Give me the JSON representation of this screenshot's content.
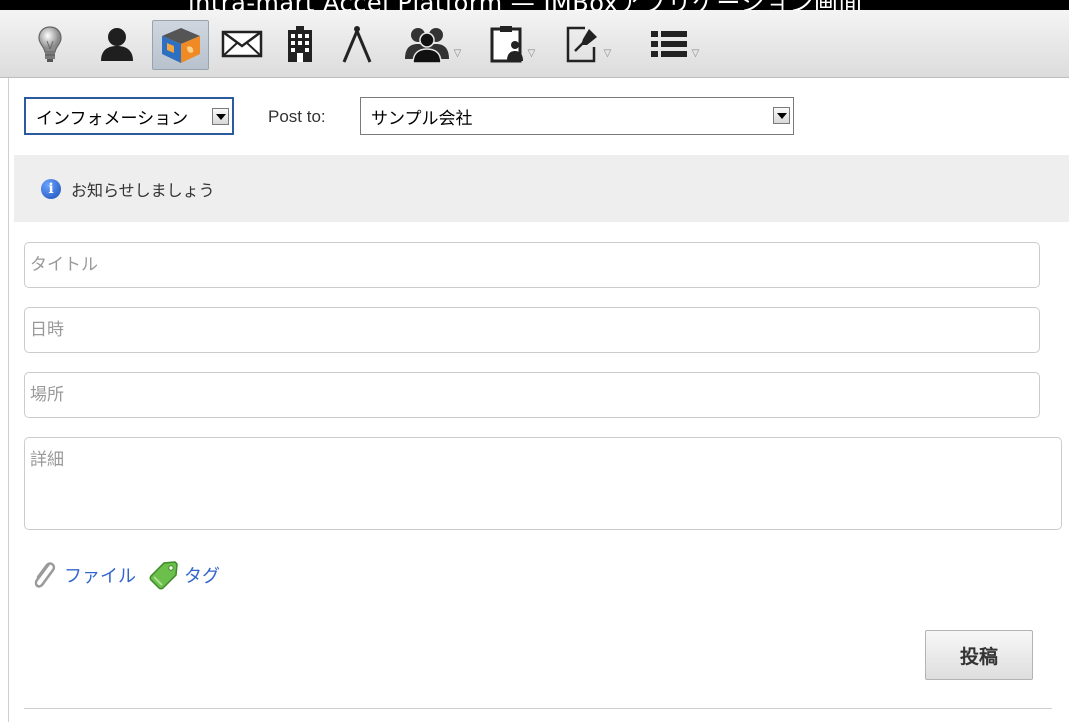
{
  "window": {
    "title": "intra-mart Accel Platform — IMBoxアプリケーション画面"
  },
  "toolbar": {
    "items": [
      {
        "name": "lightbulb-icon",
        "label": "",
        "dropdown": false
      },
      {
        "name": "user-icon",
        "label": "",
        "dropdown": false
      },
      {
        "name": "company-cube-icon",
        "label": "",
        "dropdown": false,
        "active": true
      },
      {
        "name": "mail-icon",
        "label": "",
        "dropdown": false
      },
      {
        "name": "building-icon",
        "label": "",
        "dropdown": false
      },
      {
        "name": "compass-icon",
        "label": "",
        "dropdown": false
      },
      {
        "name": "group-icon",
        "label": "",
        "dropdown": true
      },
      {
        "name": "clipboard-user-icon",
        "label": "",
        "dropdown": true
      },
      {
        "name": "document-pin-icon",
        "label": "",
        "dropdown": true
      },
      {
        "name": "list-icon",
        "label": "",
        "dropdown": true
      }
    ]
  },
  "composer": {
    "type_select": {
      "value": "インフォメーション"
    },
    "post_to_label": "Post to:",
    "post_to_select": {
      "value": "サンプル会社"
    },
    "notice": {
      "icon": "info-icon",
      "text": "お知らせしましょう"
    },
    "fields": {
      "title_placeholder": "タイトル",
      "datetime_placeholder": "日時",
      "place_placeholder": "場所",
      "detail_placeholder": "詳細"
    },
    "links": {
      "file": "ファイル",
      "tag": "タグ"
    },
    "submit_label": "投稿"
  },
  "colors": {
    "accent_blue": "#2c5aa0",
    "link_blue": "#3366cc",
    "notice_bg": "#eeeeee",
    "toolbar_active": "#b8c2cd"
  }
}
